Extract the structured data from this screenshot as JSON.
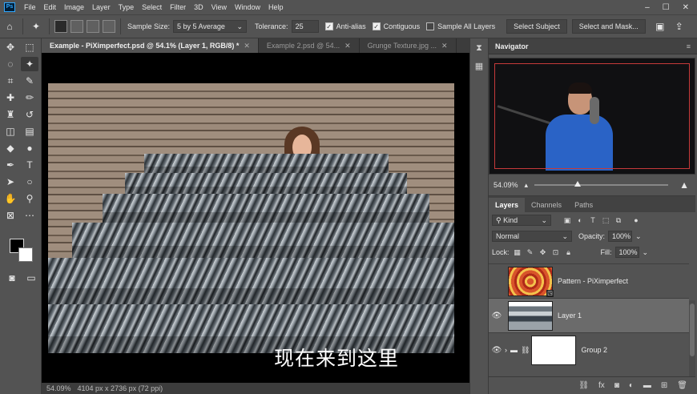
{
  "menu": {
    "logo": "Ps",
    "items": [
      "File",
      "Edit",
      "Image",
      "Layer",
      "Type",
      "Select",
      "Filter",
      "3D",
      "View",
      "Window",
      "Help"
    ],
    "window_controls": [
      "–",
      "☐",
      "✕"
    ]
  },
  "options": {
    "sample_size_label": "Sample Size:",
    "sample_size_value": "5 by 5 Average",
    "tolerance_label": "Tolerance:",
    "tolerance_value": "25",
    "anti_alias_label": "Anti-alias",
    "contiguous_label": "Contiguous",
    "sample_all_layers_label": "Sample All Layers",
    "select_subject_label": "Select Subject",
    "select_and_mask_label": "Select and Mask..."
  },
  "tabs": [
    {
      "label": "Example - PiXimperfect.psd @ 54.1% (Layer 1, RGB/8) *",
      "active": true
    },
    {
      "label": "Example 2.psd @ 54...",
      "active": false
    },
    {
      "label": "Grunge Texture.jpg ...",
      "active": false
    }
  ],
  "canvas": {
    "subtitle": "现在来到这里"
  },
  "status": {
    "zoom": "54.09%",
    "doc_info": "4104 px x 2736 px (72 ppi)"
  },
  "navigator": {
    "title": "Navigator",
    "zoom": "54.09%",
    "zoom_level": 0.32
  },
  "layers_panel": {
    "tabs": [
      "Layers",
      "Channels",
      "Paths"
    ],
    "kind_label": "Kind",
    "blend_mode": "Normal",
    "opacity_label": "Opacity:",
    "opacity_value": "100%",
    "lock_label": "Lock:",
    "fill_label": "Fill:",
    "fill_value": "100%",
    "layers": [
      {
        "name": "Pattern - PiXimperfect",
        "visible": false,
        "selected": false
      },
      {
        "name": "Layer 1",
        "visible": true,
        "selected": true
      },
      {
        "name": "Group 2",
        "visible": true,
        "selected": false
      }
    ]
  },
  "colors": {
    "accent": "#31a8ff",
    "panel": "#535353",
    "selection": "#6b6b6b"
  }
}
